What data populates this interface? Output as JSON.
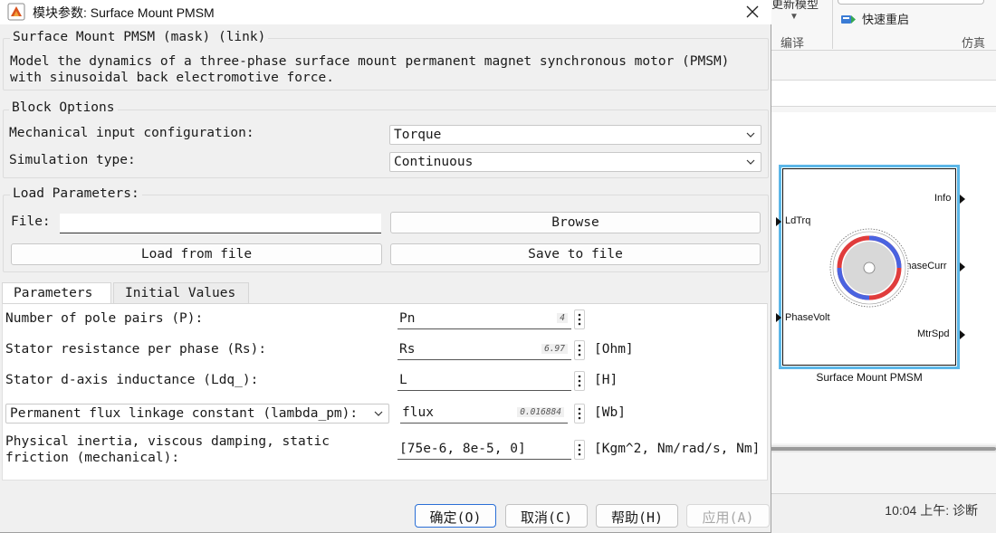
{
  "dialog": {
    "title": "模块参数: Surface Mount PMSM",
    "header": "Surface Mount PMSM (mask) (link)",
    "description_line1": "Model the dynamics of a three-phase surface mount permanent magnet synchronous motor (PMSM)",
    "description_line2": "with sinusoidal back electromotive force."
  },
  "block_options": {
    "title": "Block Options",
    "mech_label": "Mechanical input configuration:",
    "mech_value": "Torque",
    "sim_label": "Simulation type:",
    "sim_value": "Continuous"
  },
  "load_params": {
    "title": "Load Parameters:",
    "file_label": "File:",
    "file_value": "",
    "browse": "Browse",
    "load": "Load from file",
    "save": "Save to file"
  },
  "tabs": {
    "parameters": "Parameters",
    "initial_values": "Initial Values"
  },
  "params": [
    {
      "label": "Number of pole pairs (P):",
      "expr": "Pn",
      "value": "4",
      "unit": ""
    },
    {
      "label": "Stator resistance per phase (Rs):",
      "expr": "Rs",
      "value": "6.97",
      "unit": "[Ohm]"
    },
    {
      "label": "Stator d-axis inductance (Ldq_):",
      "expr": "L",
      "value": "",
      "unit": "[H]"
    },
    {
      "label": "Permanent flux linkage constant (lambda_pm):",
      "expr": "flux",
      "value": "0.016884",
      "unit": "[Wb]"
    },
    {
      "label_line1": "Physical inertia, viscous damping, static",
      "label_line2": "friction (mechanical):",
      "expr": "[75e-6, 8e-5, 0]",
      "value": "",
      "unit": "[Kgm^2, Nm/rad/s, Nm]"
    }
  ],
  "buttons": {
    "ok": "确定(O)",
    "cancel": "取消(C)",
    "help": "帮助(H)",
    "apply": "应用(A)"
  },
  "background": {
    "toolstrip_update": "更新模型",
    "toolstrip_compile": "编译",
    "quick_restart": "快速重启",
    "toolstrip_sim": "仿真",
    "status": "10:04 上午: 诊断",
    "block_caption": "Surface Mount PMSM",
    "ports": {
      "ldtrq": "LdTrq",
      "phasevolt": "PhaseVolt",
      "info": "Info",
      "phasecurr": "PhaseCurr",
      "mtrspd": "MtrSpd"
    }
  },
  "colors": {
    "accent": "#2a6fd6",
    "block_highlight": "#5cb7e8",
    "motor_red": "#e03c3c",
    "motor_blue": "#4a63e0"
  }
}
